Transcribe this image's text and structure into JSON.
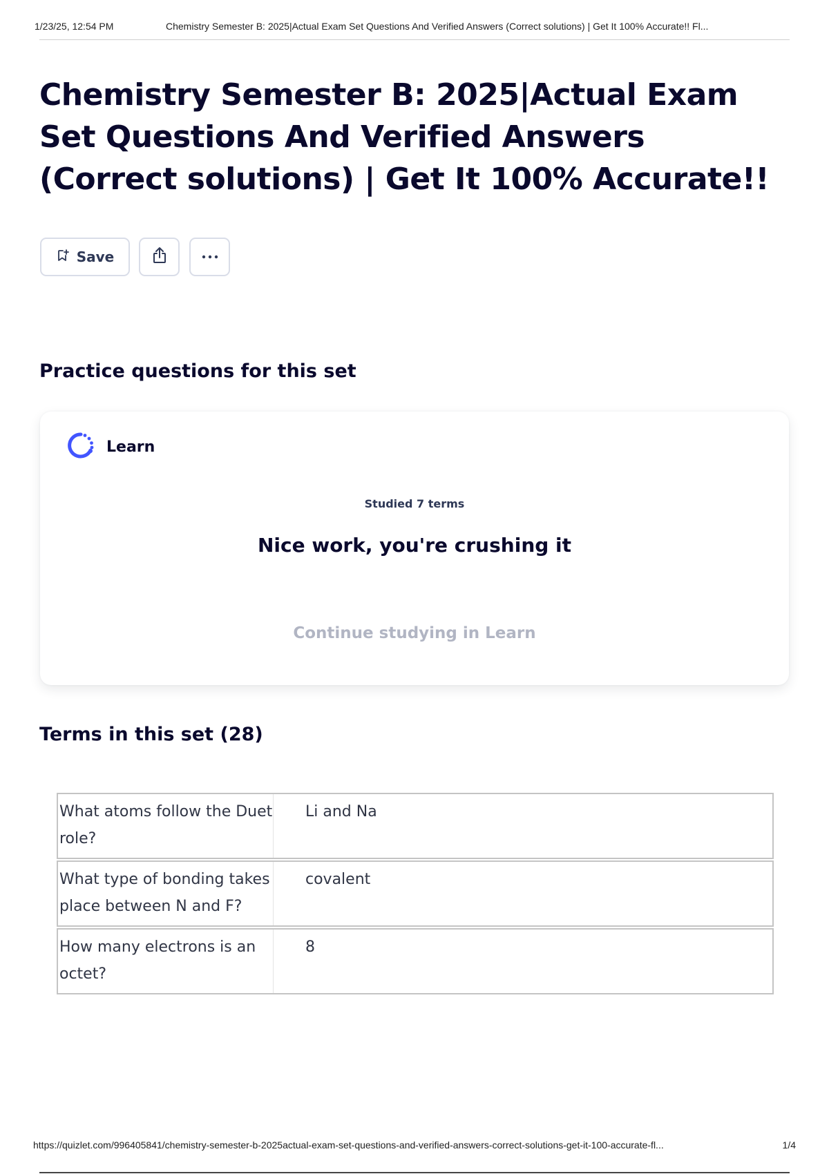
{
  "print_header": {
    "date": "1/23/25, 12:54 PM",
    "doc_title": "Chemistry Semester B: 2025|Actual Exam Set Questions And Verified Answers (Correct solutions) | Get It 100% Accurate!! Fl..."
  },
  "page": {
    "title": "Chemistry Semester B: 2025|Actual Exam Set Questions And Verified Answers (Correct solutions) | Get It 100% Accurate!!"
  },
  "toolbar": {
    "save_label": "Save",
    "icons": {
      "save": "bookmark-add-icon",
      "share": "share-icon",
      "more": "more-icon"
    }
  },
  "practice": {
    "heading": "Practice questions for this set",
    "learn_label": "Learn",
    "learn_icon": "learn-icon",
    "studied": "Studied 7 terms",
    "praise": "Nice work, you're crushing it",
    "continue": "Continue studying in Learn"
  },
  "terms": {
    "heading": "Terms in this set (28)",
    "rows": [
      {
        "term": "What atoms follow the Duet role?",
        "definition": "Li and Na"
      },
      {
        "term": "What type of bonding takes place between N and F?",
        "definition": "covalent"
      },
      {
        "term": "How many electrons is an octet?",
        "definition": "8"
      }
    ]
  },
  "print_footer": {
    "url": "https://quizlet.com/996405841/chemistry-semester-b-2025actual-exam-set-questions-and-verified-answers-correct-solutions-get-it-100-accurate-fl...",
    "page_num": "1/4"
  },
  "colors": {
    "text": "#0a092d",
    "learn_accent": "#4255ff",
    "muted": "#b1b5c3"
  }
}
